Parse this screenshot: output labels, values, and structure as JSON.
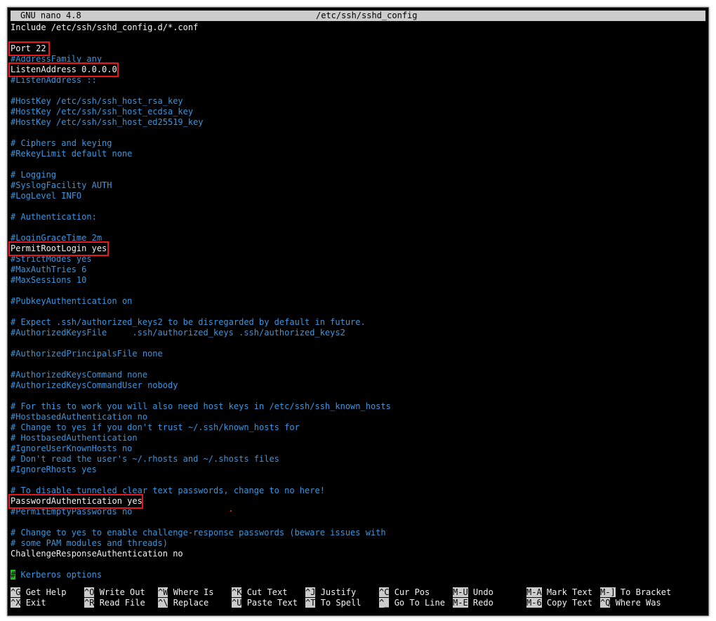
{
  "titlebar": {
    "app": "GNU nano 4.8",
    "file": "/etc/ssh/sshd_config"
  },
  "lines": [
    {
      "text": "Include /etc/ssh/sshd_config.d/*.conf",
      "color": "white"
    },
    {
      "text": "",
      "color": "white"
    },
    {
      "text": "Port 22",
      "color": "white"
    },
    {
      "text": "#AddressFamily any",
      "color": "cyan"
    },
    {
      "text": "ListenAddress 0.0.0.0",
      "color": "white"
    },
    {
      "text": "#ListenAddress ::",
      "color": "cyan"
    },
    {
      "text": "",
      "color": "white"
    },
    {
      "text": "#HostKey /etc/ssh/ssh_host_rsa_key",
      "color": "cyan"
    },
    {
      "text": "#HostKey /etc/ssh/ssh_host_ecdsa_key",
      "color": "cyan"
    },
    {
      "text": "#HostKey /etc/ssh/ssh_host_ed25519_key",
      "color": "cyan"
    },
    {
      "text": "",
      "color": "white"
    },
    {
      "text": "# Ciphers and keying",
      "color": "cyan"
    },
    {
      "text": "#RekeyLimit default none",
      "color": "cyan"
    },
    {
      "text": "",
      "color": "white"
    },
    {
      "text": "# Logging",
      "color": "cyan"
    },
    {
      "text": "#SyslogFacility AUTH",
      "color": "cyan"
    },
    {
      "text": "#LogLevel INFO",
      "color": "cyan"
    },
    {
      "text": "",
      "color": "white"
    },
    {
      "text": "# Authentication:",
      "color": "cyan"
    },
    {
      "text": "",
      "color": "white"
    },
    {
      "text": "#LoginGraceTime 2m",
      "color": "cyan"
    },
    {
      "text": "PermitRootLogin yes",
      "color": "white"
    },
    {
      "text": "#StrictModes yes",
      "color": "cyan"
    },
    {
      "text": "#MaxAuthTries 6",
      "color": "cyan"
    },
    {
      "text": "#MaxSessions 10",
      "color": "cyan"
    },
    {
      "text": "",
      "color": "white"
    },
    {
      "text": "#PubkeyAuthentication on",
      "color": "cyan"
    },
    {
      "text": "",
      "color": "white"
    },
    {
      "text": "# Expect .ssh/authorized_keys2 to be disregarded by default in future.",
      "color": "cyan"
    },
    {
      "text": "#AuthorizedKeysFile     .ssh/authorized_keys .ssh/authorized_keys2",
      "color": "cyan"
    },
    {
      "text": "",
      "color": "white"
    },
    {
      "text": "#AuthorizedPrincipalsFile none",
      "color": "cyan"
    },
    {
      "text": "",
      "color": "white"
    },
    {
      "text": "#AuthorizedKeysCommand none",
      "color": "cyan"
    },
    {
      "text": "#AuthorizedKeysCommandUser nobody",
      "color": "cyan"
    },
    {
      "text": "",
      "color": "white"
    },
    {
      "text": "# For this to work you will also need host keys in /etc/ssh/ssh_known_hosts",
      "color": "cyan"
    },
    {
      "text": "#HostbasedAuthentication no",
      "color": "cyan"
    },
    {
      "text": "# Change to yes if you don't trust ~/.ssh/known_hosts for",
      "color": "cyan"
    },
    {
      "text": "# HostbasedAuthentication",
      "color": "cyan"
    },
    {
      "text": "#IgnoreUserKnownHosts no",
      "color": "cyan"
    },
    {
      "text": "# Don't read the user's ~/.rhosts and ~/.shosts files",
      "color": "cyan"
    },
    {
      "text": "#IgnoreRhosts yes",
      "color": "cyan"
    },
    {
      "text": "",
      "color": "white"
    },
    {
      "text": "# To disable tunneled clear text passwords, change to no here!",
      "color": "cyan"
    },
    {
      "text": "PasswordAuthentication yes",
      "color": "white"
    },
    {
      "text": "#PermitEmptyPasswords no",
      "color": "cyan"
    },
    {
      "text": "",
      "color": "white"
    },
    {
      "text": "# Change to yes to enable challenge-response passwords (beware issues with",
      "color": "cyan"
    },
    {
      "text": "# some PAM modules and threads)",
      "color": "cyan"
    },
    {
      "text": "ChallengeResponseAuthentication no",
      "color": "white"
    },
    {
      "text": "",
      "color": "white"
    },
    {
      "text": "# Kerberos options",
      "color": "cyan",
      "cursor": true
    }
  ],
  "highlighted_lines": [
    2,
    4,
    21,
    45
  ],
  "shortcuts_row1": [
    {
      "key": "^G",
      "label": "Get Help"
    },
    {
      "key": "^O",
      "label": "Write Out"
    },
    {
      "key": "^W",
      "label": "Where Is"
    },
    {
      "key": "^K",
      "label": "Cut Text"
    },
    {
      "key": "^J",
      "label": "Justify"
    },
    {
      "key": "^C",
      "label": "Cur Pos"
    },
    {
      "key": "M-U",
      "label": "Undo"
    },
    {
      "key": "M-A",
      "label": "Mark Text"
    },
    {
      "key": "M-]",
      "label": "To Bracket"
    }
  ],
  "shortcuts_row2": [
    {
      "key": "^X",
      "label": "Exit"
    },
    {
      "key": "^R",
      "label": "Read File"
    },
    {
      "key": "^\\",
      "label": "Replace"
    },
    {
      "key": "^U",
      "label": "Paste Text"
    },
    {
      "key": "^T",
      "label": "To Spell"
    },
    {
      "key": "^_",
      "label": "Go To Line"
    },
    {
      "key": "M-E",
      "label": "Redo"
    },
    {
      "key": "M-6",
      "label": "Copy Text"
    },
    {
      "key": "^Q",
      "label": "Where Was"
    }
  ],
  "colors": {
    "background": "#000000",
    "text": "#f2f2f2",
    "comment": "#3a96dd",
    "titlebar": "#cccccc",
    "cursor": "#16c60c",
    "highlight": "#e81818"
  }
}
